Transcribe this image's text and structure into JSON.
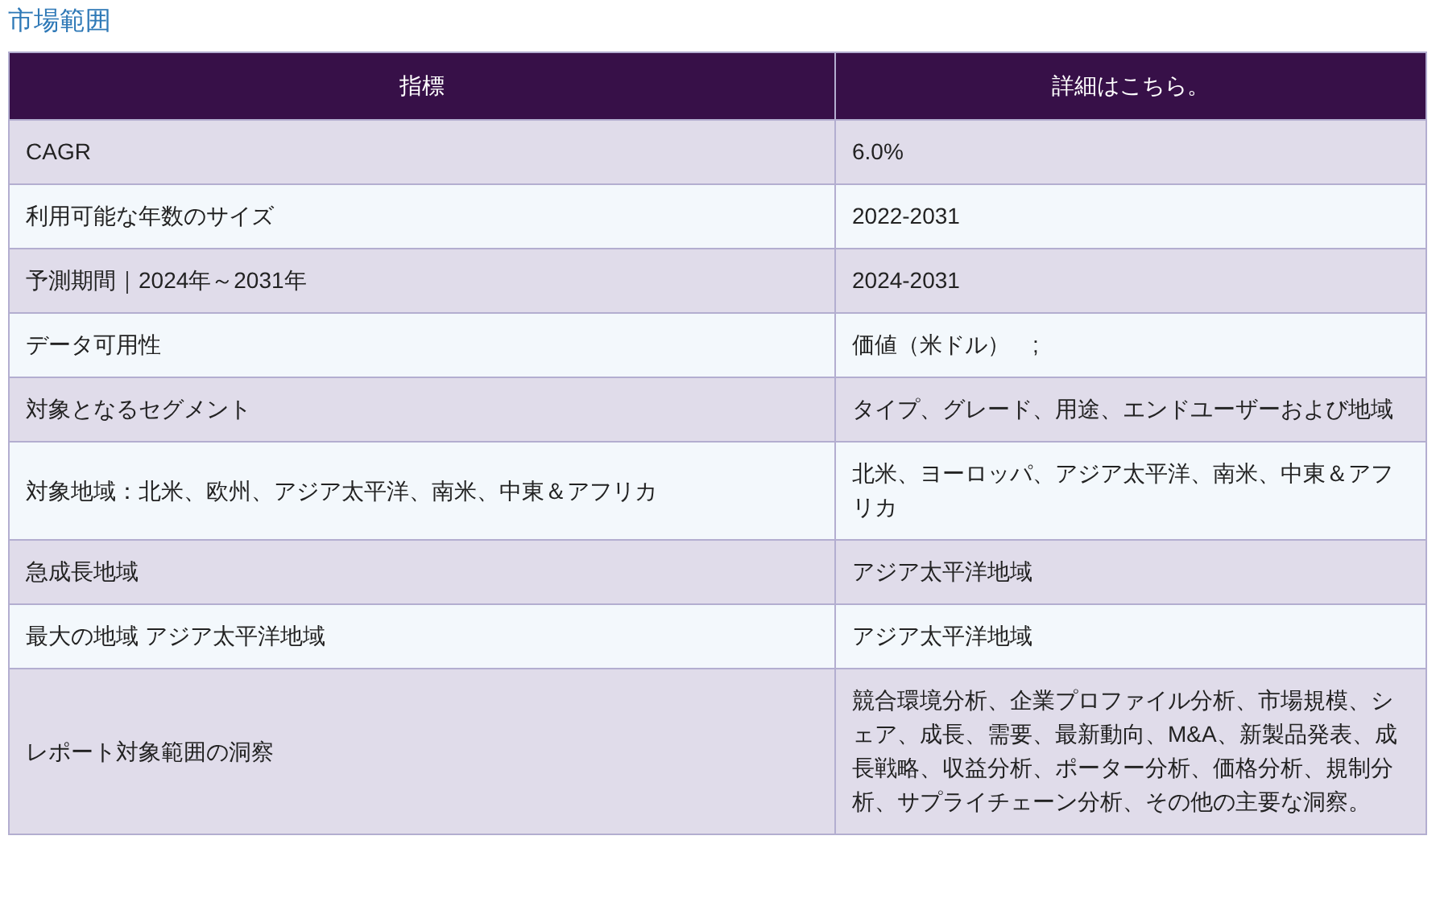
{
  "title": "市場範囲",
  "table": {
    "columns": [
      "指標",
      "詳細はこちら。"
    ],
    "rows": [
      [
        "CAGR",
        "6.0%"
      ],
      [
        "利用可能な年数のサイズ",
        "2022-2031"
      ],
      [
        "予測期間｜2024年～2031年",
        "2024-2031"
      ],
      [
        "データ可用性",
        "価値（米ドル）　;"
      ],
      [
        "対象となるセグメント",
        "タイプ、グレード、用途、エンドユーザーおよび地域"
      ],
      [
        "対象地域：北米、欧州、アジア太平洋、南米、中東＆アフリカ",
        "北米、ヨーロッパ、アジア太平洋、南米、中東＆アフリカ"
      ],
      [
        "急成長地域",
        "アジア太平洋地域"
      ],
      [
        "最大の地域 アジア太平洋地域",
        "アジア太平洋地域"
      ],
      [
        "レポート対象範囲の洞察",
        "競合環境分析、企業プロファイル分析、市場規模、シェア、成長、需要、最新動向、M&A、新製品発表、成長戦略、収益分析、ポーター分析、価格分析、規制分析、サプライチェーン分析、その他の主要な洞察。"
      ]
    ]
  }
}
